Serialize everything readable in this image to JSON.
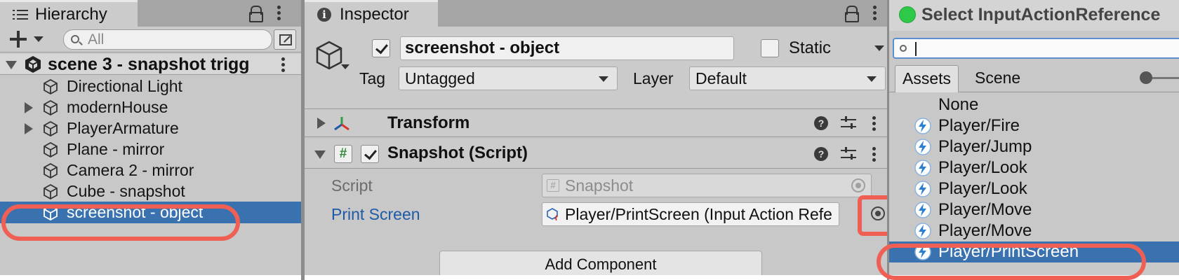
{
  "hierarchy": {
    "tab_label": "Hierarchy",
    "search_placeholder": "All",
    "scene_name": "scene 3 - snapshot trigg",
    "items": [
      {
        "label": "Directional Light",
        "expandable": false
      },
      {
        "label": "modernHouse",
        "expandable": true
      },
      {
        "label": "PlayerArmature",
        "expandable": true
      },
      {
        "label": "Plane - mirror",
        "expandable": false
      },
      {
        "label": "Camera 2 - mirror",
        "expandable": false
      },
      {
        "label": "Cube - snapshot",
        "expandable": false
      },
      {
        "label": "screenshot - object",
        "expandable": false,
        "selected": true
      }
    ]
  },
  "inspector": {
    "tab_label": "Inspector",
    "object_name": "screenshot - object",
    "active": true,
    "static_label": "Static",
    "static_checked": false,
    "tag_label": "Tag",
    "tag_value": "Untagged",
    "layer_label": "Layer",
    "layer_value": "Default",
    "components": [
      {
        "title": "Transform",
        "expanded": false
      },
      {
        "title": "Snapshot (Script)",
        "expanded": true,
        "enabled": true
      }
    ],
    "script_label": "Script",
    "script_value": "Snapshot",
    "print_screen_label": "Print Screen",
    "print_screen_value": "Player/PrintScreen (Input Action Refe",
    "add_component_label": "Add Component"
  },
  "select_window": {
    "title": "Select InputActionReference",
    "search_value": "",
    "tabs": [
      "Assets",
      "Scene"
    ],
    "active_tab": "Assets",
    "none_label": "None",
    "items": [
      "Player/Fire",
      "Player/Jump",
      "Player/Look",
      "Player/Look",
      "Player/Move",
      "Player/Move",
      "Player/PrintScreen"
    ],
    "highlighted_item": "Player/PrintScreen"
  },
  "colors": {
    "selection": "#3a72b0",
    "callout": "#ef5f53",
    "link_blue": "#1e5aa8",
    "window_green": "#2fc94a"
  }
}
